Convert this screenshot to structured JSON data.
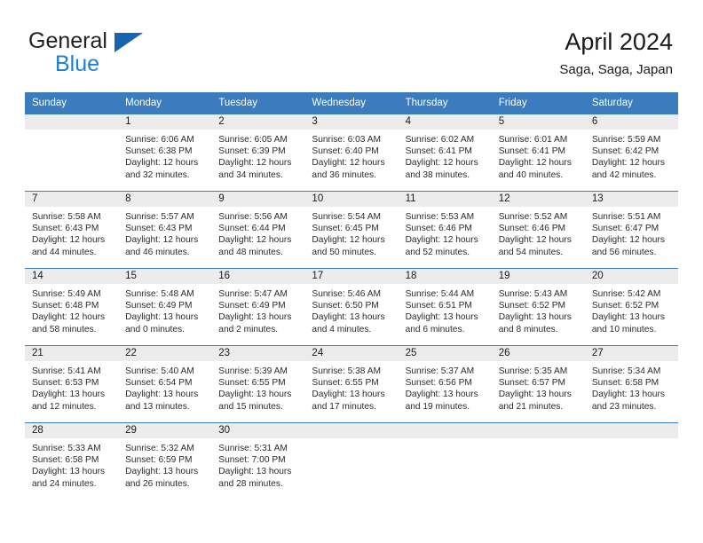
{
  "brand": {
    "name_part1": "General",
    "name_part2": "Blue",
    "triangle_color": "#1565b0",
    "blue_color": "#1b7fd4"
  },
  "header": {
    "title": "April 2024",
    "subtitle": "Saga, Saga, Japan"
  },
  "theme": {
    "header_bg": "#3a7cbe",
    "daynum_bg": "#ececec",
    "rule_color": "#3a7cbe",
    "text_color": "#2b2b2b"
  },
  "weekday_headers": [
    "Sunday",
    "Monday",
    "Tuesday",
    "Wednesday",
    "Thursday",
    "Friday",
    "Saturday"
  ],
  "labels": {
    "sunrise_prefix": "Sunrise:",
    "sunset_prefix": "Sunset:",
    "daylight_prefix": "Daylight:"
  },
  "weeks": [
    [
      {
        "day": "",
        "line1": "",
        "line2": "",
        "line3": "",
        "line4": ""
      },
      {
        "day": "1",
        "line1": "Sunrise: 6:06 AM",
        "line2": "Sunset: 6:38 PM",
        "line3": "Daylight: 12 hours",
        "line4": "and 32 minutes."
      },
      {
        "day": "2",
        "line1": "Sunrise: 6:05 AM",
        "line2": "Sunset: 6:39 PM",
        "line3": "Daylight: 12 hours",
        "line4": "and 34 minutes."
      },
      {
        "day": "3",
        "line1": "Sunrise: 6:03 AM",
        "line2": "Sunset: 6:40 PM",
        "line3": "Daylight: 12 hours",
        "line4": "and 36 minutes."
      },
      {
        "day": "4",
        "line1": "Sunrise: 6:02 AM",
        "line2": "Sunset: 6:41 PM",
        "line3": "Daylight: 12 hours",
        "line4": "and 38 minutes."
      },
      {
        "day": "5",
        "line1": "Sunrise: 6:01 AM",
        "line2": "Sunset: 6:41 PM",
        "line3": "Daylight: 12 hours",
        "line4": "and 40 minutes."
      },
      {
        "day": "6",
        "line1": "Sunrise: 5:59 AM",
        "line2": "Sunset: 6:42 PM",
        "line3": "Daylight: 12 hours",
        "line4": "and 42 minutes."
      }
    ],
    [
      {
        "day": "7",
        "line1": "Sunrise: 5:58 AM",
        "line2": "Sunset: 6:43 PM",
        "line3": "Daylight: 12 hours",
        "line4": "and 44 minutes."
      },
      {
        "day": "8",
        "line1": "Sunrise: 5:57 AM",
        "line2": "Sunset: 6:43 PM",
        "line3": "Daylight: 12 hours",
        "line4": "and 46 minutes."
      },
      {
        "day": "9",
        "line1": "Sunrise: 5:56 AM",
        "line2": "Sunset: 6:44 PM",
        "line3": "Daylight: 12 hours",
        "line4": "and 48 minutes."
      },
      {
        "day": "10",
        "line1": "Sunrise: 5:54 AM",
        "line2": "Sunset: 6:45 PM",
        "line3": "Daylight: 12 hours",
        "line4": "and 50 minutes."
      },
      {
        "day": "11",
        "line1": "Sunrise: 5:53 AM",
        "line2": "Sunset: 6:46 PM",
        "line3": "Daylight: 12 hours",
        "line4": "and 52 minutes."
      },
      {
        "day": "12",
        "line1": "Sunrise: 5:52 AM",
        "line2": "Sunset: 6:46 PM",
        "line3": "Daylight: 12 hours",
        "line4": "and 54 minutes."
      },
      {
        "day": "13",
        "line1": "Sunrise: 5:51 AM",
        "line2": "Sunset: 6:47 PM",
        "line3": "Daylight: 12 hours",
        "line4": "and 56 minutes."
      }
    ],
    [
      {
        "day": "14",
        "line1": "Sunrise: 5:49 AM",
        "line2": "Sunset: 6:48 PM",
        "line3": "Daylight: 12 hours",
        "line4": "and 58 minutes."
      },
      {
        "day": "15",
        "line1": "Sunrise: 5:48 AM",
        "line2": "Sunset: 6:49 PM",
        "line3": "Daylight: 13 hours",
        "line4": "and 0 minutes."
      },
      {
        "day": "16",
        "line1": "Sunrise: 5:47 AM",
        "line2": "Sunset: 6:49 PM",
        "line3": "Daylight: 13 hours",
        "line4": "and 2 minutes."
      },
      {
        "day": "17",
        "line1": "Sunrise: 5:46 AM",
        "line2": "Sunset: 6:50 PM",
        "line3": "Daylight: 13 hours",
        "line4": "and 4 minutes."
      },
      {
        "day": "18",
        "line1": "Sunrise: 5:44 AM",
        "line2": "Sunset: 6:51 PM",
        "line3": "Daylight: 13 hours",
        "line4": "and 6 minutes."
      },
      {
        "day": "19",
        "line1": "Sunrise: 5:43 AM",
        "line2": "Sunset: 6:52 PM",
        "line3": "Daylight: 13 hours",
        "line4": "and 8 minutes."
      },
      {
        "day": "20",
        "line1": "Sunrise: 5:42 AM",
        "line2": "Sunset: 6:52 PM",
        "line3": "Daylight: 13 hours",
        "line4": "and 10 minutes."
      }
    ],
    [
      {
        "day": "21",
        "line1": "Sunrise: 5:41 AM",
        "line2": "Sunset: 6:53 PM",
        "line3": "Daylight: 13 hours",
        "line4": "and 12 minutes."
      },
      {
        "day": "22",
        "line1": "Sunrise: 5:40 AM",
        "line2": "Sunset: 6:54 PM",
        "line3": "Daylight: 13 hours",
        "line4": "and 13 minutes."
      },
      {
        "day": "23",
        "line1": "Sunrise: 5:39 AM",
        "line2": "Sunset: 6:55 PM",
        "line3": "Daylight: 13 hours",
        "line4": "and 15 minutes."
      },
      {
        "day": "24",
        "line1": "Sunrise: 5:38 AM",
        "line2": "Sunset: 6:55 PM",
        "line3": "Daylight: 13 hours",
        "line4": "and 17 minutes."
      },
      {
        "day": "25",
        "line1": "Sunrise: 5:37 AM",
        "line2": "Sunset: 6:56 PM",
        "line3": "Daylight: 13 hours",
        "line4": "and 19 minutes."
      },
      {
        "day": "26",
        "line1": "Sunrise: 5:35 AM",
        "line2": "Sunset: 6:57 PM",
        "line3": "Daylight: 13 hours",
        "line4": "and 21 minutes."
      },
      {
        "day": "27",
        "line1": "Sunrise: 5:34 AM",
        "line2": "Sunset: 6:58 PM",
        "line3": "Daylight: 13 hours",
        "line4": "and 23 minutes."
      }
    ],
    [
      {
        "day": "28",
        "line1": "Sunrise: 5:33 AM",
        "line2": "Sunset: 6:58 PM",
        "line3": "Daylight: 13 hours",
        "line4": "and 24 minutes."
      },
      {
        "day": "29",
        "line1": "Sunrise: 5:32 AM",
        "line2": "Sunset: 6:59 PM",
        "line3": "Daylight: 13 hours",
        "line4": "and 26 minutes."
      },
      {
        "day": "30",
        "line1": "Sunrise: 5:31 AM",
        "line2": "Sunset: 7:00 PM",
        "line3": "Daylight: 13 hours",
        "line4": "and 28 minutes."
      },
      {
        "day": "",
        "line1": "",
        "line2": "",
        "line3": "",
        "line4": ""
      },
      {
        "day": "",
        "line1": "",
        "line2": "",
        "line3": "",
        "line4": ""
      },
      {
        "day": "",
        "line1": "",
        "line2": "",
        "line3": "",
        "line4": ""
      },
      {
        "day": "",
        "line1": "",
        "line2": "",
        "line3": "",
        "line4": ""
      }
    ]
  ]
}
